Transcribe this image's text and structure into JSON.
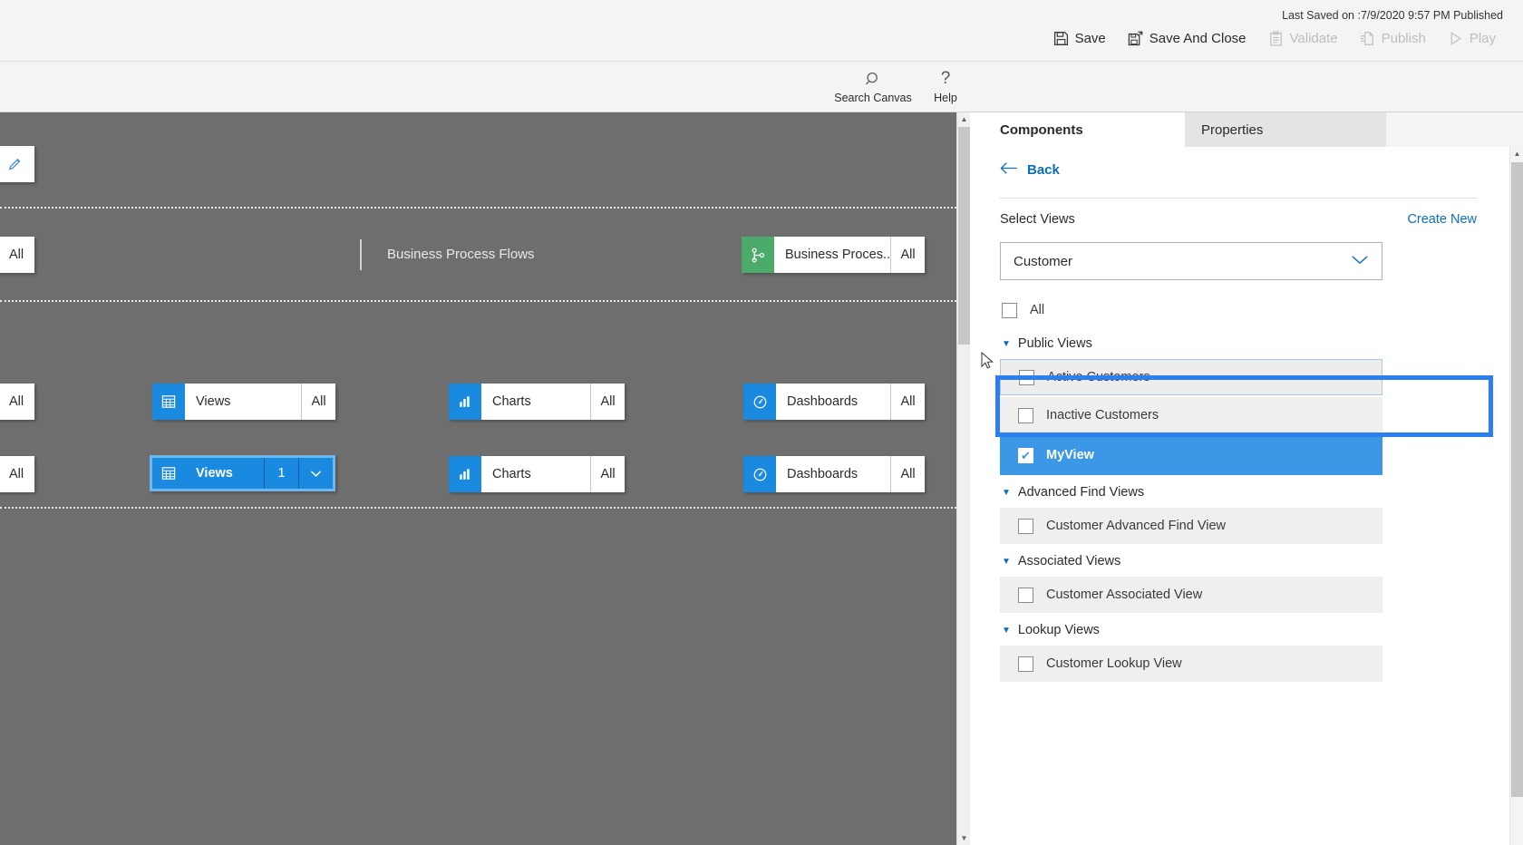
{
  "topbar": {
    "last_saved": "Last Saved on :7/9/2020 9:57 PM Published",
    "commands": [
      {
        "label": "Save",
        "icon": "save-icon",
        "enabled": true
      },
      {
        "label": "Save And Close",
        "icon": "save-and-close-icon",
        "enabled": true
      },
      {
        "label": "Validate",
        "icon": "validate-icon",
        "enabled": false
      },
      {
        "label": "Publish",
        "icon": "publish-icon",
        "enabled": false
      },
      {
        "label": "Play",
        "icon": "play-icon",
        "enabled": false
      }
    ]
  },
  "toolbar": {
    "items": [
      {
        "label": "Search Canvas",
        "icon": "search-icon"
      },
      {
        "label": "Help",
        "icon": "help-icon"
      }
    ]
  },
  "canvas": {
    "edit_tile": {
      "icon": "pencil-icon"
    },
    "section_label": "Business Process Flows",
    "rows": [
      {
        "stub_label": "All",
        "tiles": [
          {
            "label": "Business Proces...",
            "count": "All",
            "icon": "bpf-icon",
            "color": "green",
            "selected": false
          }
        ]
      },
      {
        "stub_label": "All",
        "tiles": [
          {
            "label": "Views",
            "count": "All",
            "icon": "views-grid-icon",
            "color": "blue",
            "selected": false
          },
          {
            "label": "Charts",
            "count": "All",
            "icon": "chart-bar-icon",
            "color": "blue",
            "selected": false
          },
          {
            "label": "Dashboards",
            "count": "All",
            "icon": "dashboard-gauge-icon",
            "color": "blue",
            "selected": false
          }
        ]
      },
      {
        "stub_label": "All",
        "tiles": [
          {
            "label": "Views",
            "count": "1",
            "icon": "views-grid-icon",
            "color": "blue",
            "selected": true,
            "chevron": "chevron-down-icon"
          },
          {
            "label": "Charts",
            "count": "All",
            "icon": "chart-bar-icon",
            "color": "blue",
            "selected": false
          },
          {
            "label": "Dashboards",
            "count": "All",
            "icon": "dashboard-gauge-icon",
            "color": "blue",
            "selected": false
          }
        ]
      }
    ]
  },
  "panel": {
    "tabs": [
      {
        "label": "Components",
        "active": true
      },
      {
        "label": "Properties",
        "active": false
      }
    ],
    "back_label": "Back",
    "select_views_label": "Select Views",
    "create_new_label": "Create New",
    "entity_combo": {
      "value": "Customer",
      "chevron": "chevron-down-icon"
    },
    "all_checkbox": {
      "label": "All",
      "checked": false
    },
    "groups": [
      {
        "title": "Public Views",
        "items": [
          {
            "label": "Active Customers",
            "checked": false,
            "state": "hover"
          },
          {
            "label": "Inactive Customers",
            "checked": false,
            "state": "normal"
          },
          {
            "label": "MyView",
            "checked": true,
            "state": "selected"
          }
        ]
      },
      {
        "title": "Advanced Find Views",
        "items": [
          {
            "label": "Customer Advanced Find View",
            "checked": false,
            "state": "normal"
          }
        ]
      },
      {
        "title": "Associated Views",
        "items": [
          {
            "label": "Customer Associated View",
            "checked": false,
            "state": "normal"
          }
        ]
      },
      {
        "title": "Lookup Views",
        "items": [
          {
            "label": "Customer Lookup View",
            "checked": false,
            "state": "normal"
          }
        ]
      }
    ]
  },
  "colors": {
    "accent_blue": "#1a8ae0",
    "link_blue": "#0a6ebd",
    "selection_blue": "#3c97e6",
    "highlight_blue": "#2d7ff0",
    "canvas_gray": "#6e6e6e",
    "green": "#4cab6a"
  }
}
